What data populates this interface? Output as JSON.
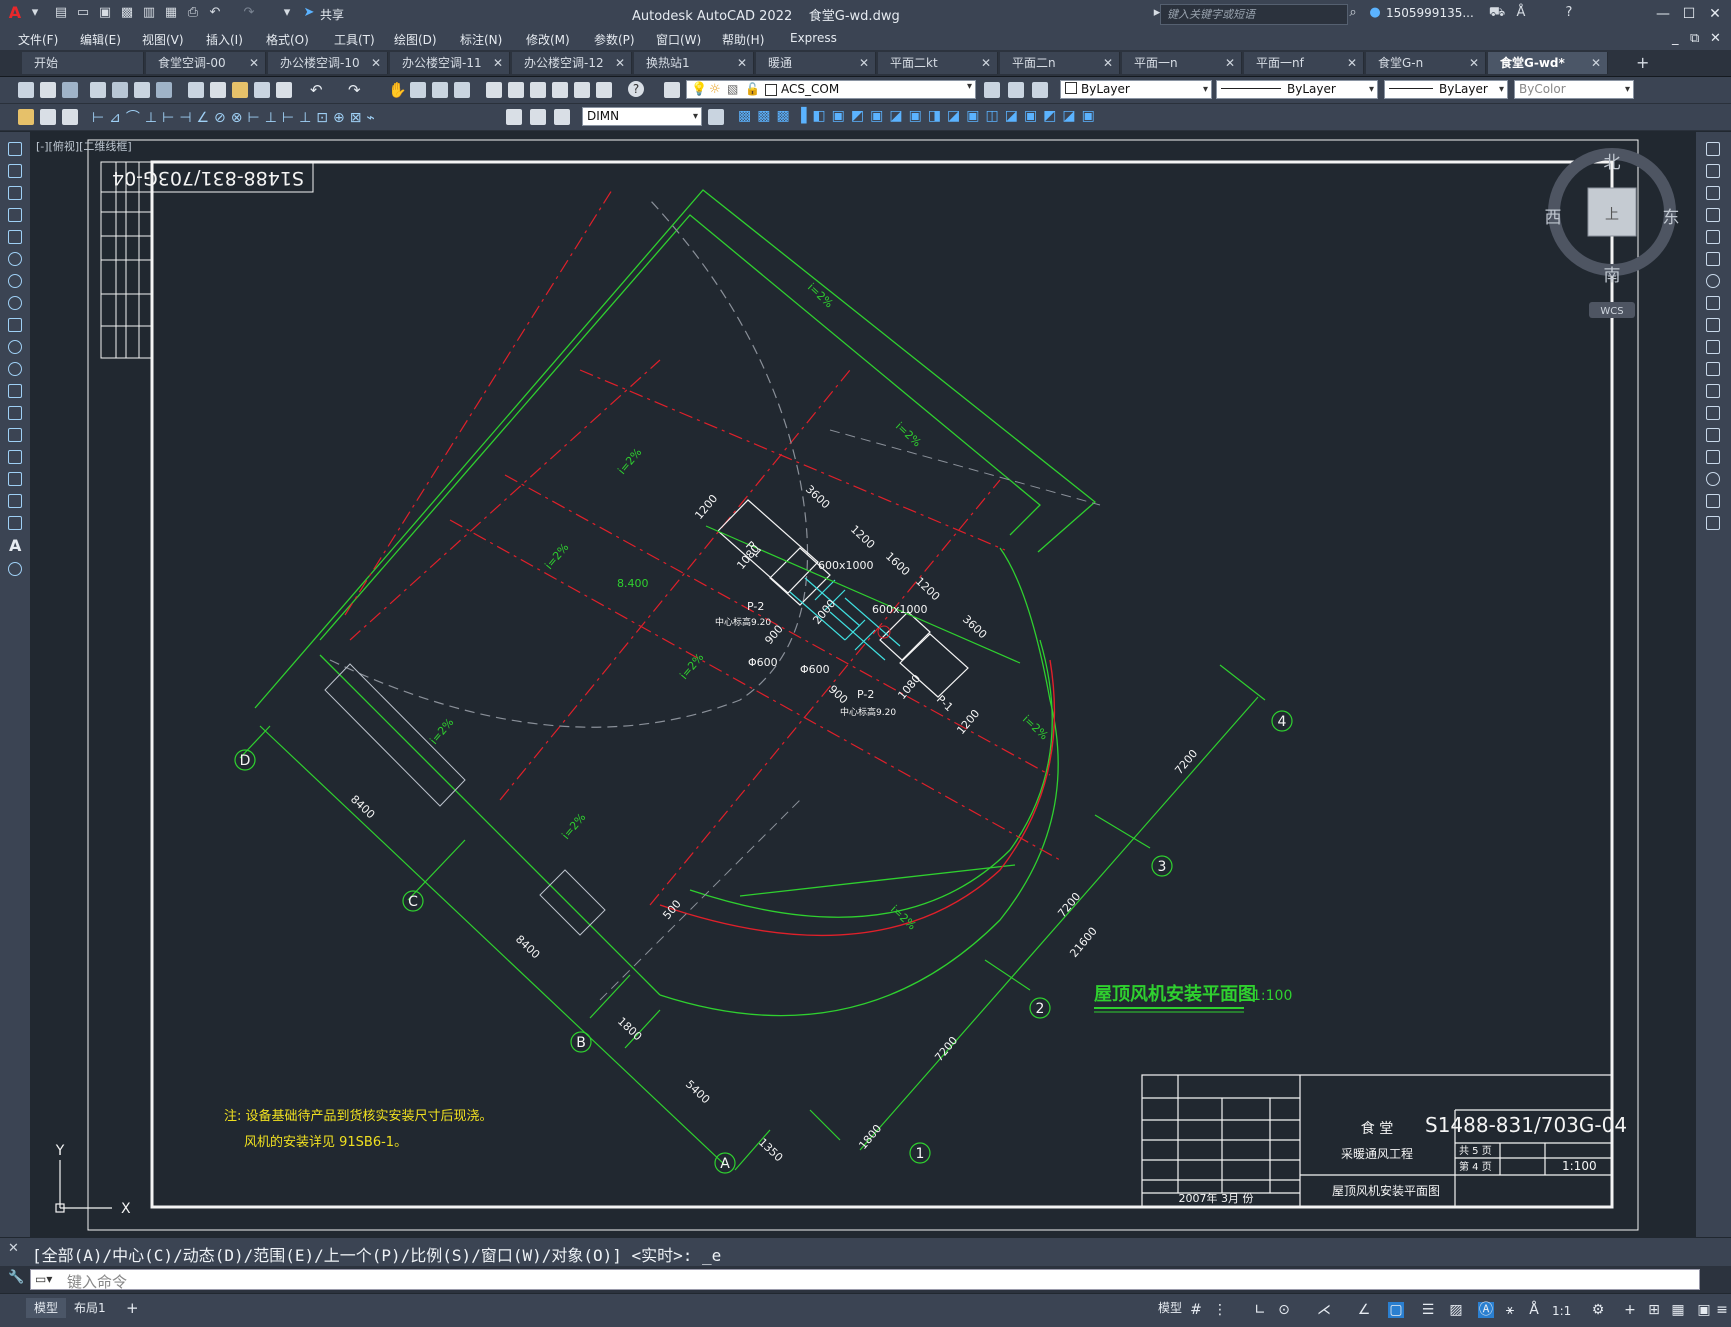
{
  "app": {
    "title": "Autodesk AutoCAD 2022",
    "file": "食堂G-wd.dwg",
    "search_placeholder": "键入关键字或短语",
    "user": "1505999135...",
    "share": "共享"
  },
  "menu": [
    "文件(F)",
    "编辑(E)",
    "视图(V)",
    "插入(I)",
    "格式(O)",
    "工具(T)",
    "绘图(D)",
    "标注(N)",
    "修改(M)",
    "参数(P)",
    "窗口(W)",
    "帮助(H)",
    "Express"
  ],
  "tabs": [
    "开始",
    "食堂空调-00",
    "办公楼空调-10",
    "办公楼空调-11",
    "办公楼空调-12",
    "换热站1",
    "暖通",
    "平面二kt",
    "平面二n",
    "平面一n",
    "平面一nf",
    "食堂G-n",
    "食堂G-wd*"
  ],
  "toolbar": {
    "layer": "ACS_COM",
    "color": "ByLayer",
    "linetype": "ByLayer",
    "lineweight": "ByLayer",
    "plotstyle": "ByColor",
    "dimstyle": "DIMN"
  },
  "viewport": {
    "label": "[-][俯视][二维线框]",
    "compass": {
      "n": "北",
      "s": "南",
      "e": "东",
      "w": "西",
      "center": "上",
      "wcs": "WCS"
    }
  },
  "drawing": {
    "stamp": "S1488-831/703G-04",
    "title": "屋顶风机安装平面图",
    "scale": "1:100",
    "notes": [
      "注: 设备基础待产品到货核实安装尺寸后现浇。",
      "风机的安装详见 91SB6-1。"
    ],
    "grid_letters": [
      "D",
      "C",
      "B",
      "A"
    ],
    "grid_numbers": [
      "4",
      "3",
      "2",
      "1"
    ],
    "dims": [
      "8400",
      "8400",
      "1800",
      "5400",
      "1350",
      "7200",
      "7200",
      "21600",
      "7200",
      "1800",
      "3600",
      "1200",
      "1200",
      "1600",
      "1200",
      "3600",
      "1200",
      "500"
    ],
    "slope": "i=2%",
    "elevation": "8.400",
    "equipment": [
      "P-1",
      "P-2",
      "P-2",
      "P-1"
    ],
    "duct_sizes": [
      "600x1000",
      "600x1000"
    ],
    "pipe": [
      "Φ600",
      "Φ600"
    ],
    "center_elev": [
      "中心标高9.20",
      "中心标高9.20"
    ],
    "misc_dims": [
      "1080",
      "1080",
      "900",
      "900",
      "2000"
    ]
  },
  "titleblock": {
    "project": "食     堂",
    "subtitle": "采暖通风工程",
    "sheet": "屋顶风机安装平面图",
    "code": "S1488-831/703G-04",
    "date": "2007年 3月 份",
    "scale": "1:100",
    "total": "共 5 页",
    "page": "第 4 页"
  },
  "command": {
    "history": "[全部(A)/中心(C)/动态(D)/范围(E)/上一个(P)/比例(S)/窗口(W)/对象(O)] <实时>: _e",
    "placeholder": "键入命令"
  },
  "status": {
    "model": "模型",
    "layout": "布局1",
    "model_btn": "模型",
    "scale": "1:1"
  },
  "colors": {
    "green": "#2fd02f",
    "red": "#e0202a",
    "cyan": "#40e0e0",
    "white": "#f4f4f4",
    "yellow": "#f0e020"
  }
}
